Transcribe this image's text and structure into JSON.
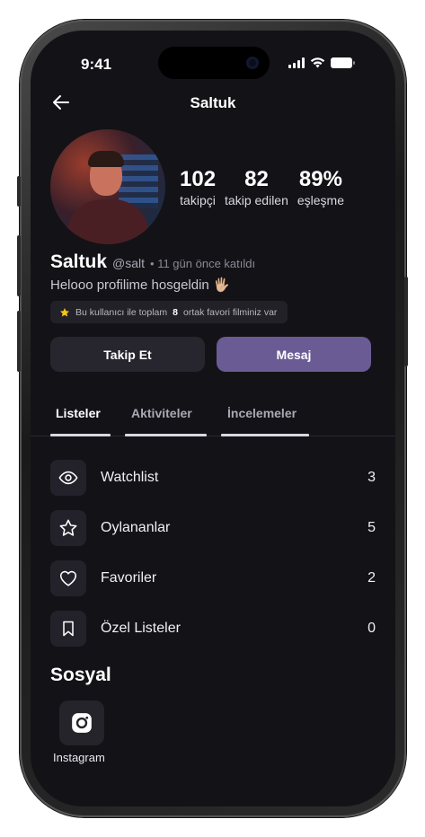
{
  "status": {
    "time": "9:41"
  },
  "nav": {
    "title": "Saltuk"
  },
  "profile": {
    "name": "Saltuk",
    "handle": "@salt",
    "joined": "• 11 gün önce katıldı",
    "bio": "Helooo profilime hosgeldin 🖐🏼",
    "common_prefix": "Bu kullanıcı ile toplam",
    "common_count": "8",
    "common_suffix": "ortak favori filminiz var"
  },
  "stats": [
    {
      "value": "102",
      "label": "takipçi"
    },
    {
      "value": "82",
      "label": "takip edilen"
    },
    {
      "value": "89%",
      "label": "eşleşme"
    }
  ],
  "buttons": {
    "follow": "Takip Et",
    "message": "Mesaj"
  },
  "tabs": [
    {
      "label": "Listeler",
      "active": true
    },
    {
      "label": "Aktiviteler",
      "active": false
    },
    {
      "label": "İncelemeler",
      "active": false
    }
  ],
  "lists": [
    {
      "icon": "eye-icon",
      "label": "Watchlist",
      "count": "3"
    },
    {
      "icon": "star-icon",
      "label": "Oylananlar",
      "count": "5"
    },
    {
      "icon": "heart-icon",
      "label": "Favoriler",
      "count": "2"
    },
    {
      "icon": "bookmark-icon",
      "label": "Özel Listeler",
      "count": "0"
    }
  ],
  "social": {
    "title": "Sosyal",
    "instagram_label": "Instagram"
  },
  "colors": {
    "background": "#131217",
    "accent": "#6a5b94",
    "card": "#23222a"
  }
}
